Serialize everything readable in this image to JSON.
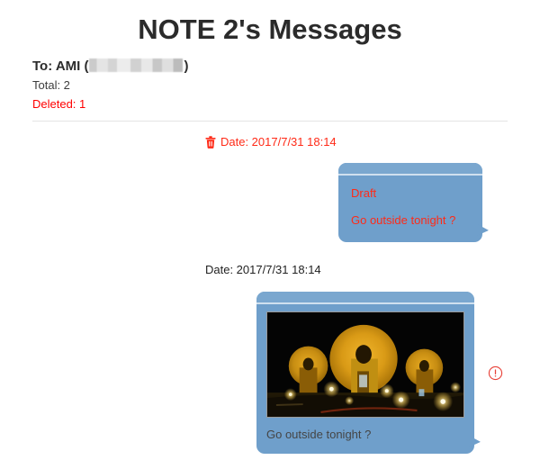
{
  "page": {
    "title": "NOTE 2's Messages"
  },
  "header": {
    "to_label": "To: AMI (",
    "to_close": ")",
    "recipient_name": "AMI",
    "recipient_number_redacted": true,
    "total_line": "Total: 2",
    "deleted_line": "Deleted: 1"
  },
  "colors": {
    "bubble_blue": "#6f9fcb",
    "bubble_cap_blue": "#7aa7cf",
    "deleted_red": "#ff0000",
    "date_red": "#ff2a17",
    "draft_red": "#ff2a17",
    "caption_gray": "#454545",
    "title_dark": "#2b2b2b",
    "divider_gray": "#e4e4e4"
  },
  "messages": [
    {
      "id": "msg-1",
      "deleted": true,
      "date_text": "Date: 2017/7/31 18:14",
      "icon": "trash-icon",
      "bubble_kind": "draft",
      "draft_label": "Draft",
      "body_text": "Go outside tonight ?",
      "has_attachment": false,
      "status_icon": null
    },
    {
      "id": "msg-2",
      "deleted": false,
      "date_text": "Date: 2017/7/31 18:14",
      "icon": null,
      "bubble_kind": "photo",
      "draft_label": null,
      "body_text": "Go outside tonight ?",
      "has_attachment": true,
      "attachment_alt": "Night photo of illuminated golden dome structures",
      "status_icon": "alert-circle-icon"
    }
  ]
}
